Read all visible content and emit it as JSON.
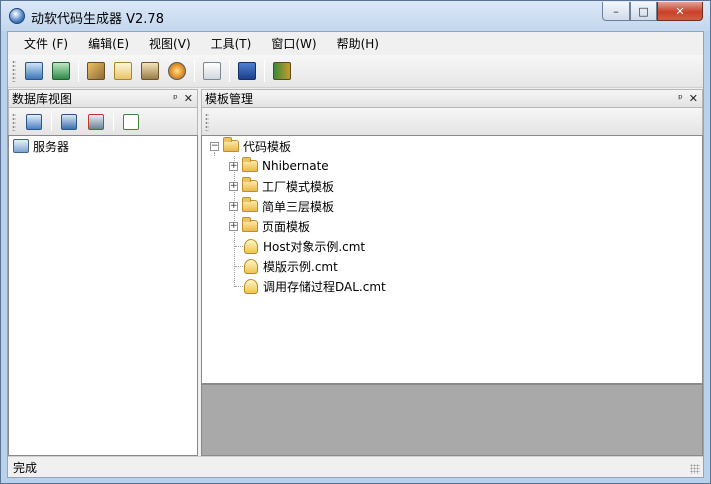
{
  "window": {
    "title": "动软代码生成器  V2.78",
    "minimize_glyph": "–",
    "maximize_glyph": "□",
    "close_glyph": "✕"
  },
  "menu": {
    "items": [
      "文件 (F)",
      "编辑(E)",
      "视图(V)",
      "工具(T)",
      "窗口(W)",
      "帮助(H)"
    ]
  },
  "toolbar": {
    "icons": [
      "server-connect-icon",
      "code-generator-icon",
      "tools-icon",
      "document-icon",
      "batch-icon",
      "refresh-gear-icon",
      "clipboard-icon",
      "word-icon",
      "exit-icon"
    ]
  },
  "left_panel": {
    "title": "数据库视图",
    "pin_glyph": "ᵖ",
    "close_glyph": "✕",
    "toolbar_icons": [
      "add-server-icon",
      "connect-icon",
      "disconnect-icon",
      "refresh-icon"
    ],
    "tree": [
      {
        "label": "服务器",
        "icon": "server-icon"
      }
    ]
  },
  "right_panel": {
    "title": "模板管理",
    "pin_glyph": "ᵖ",
    "close_glyph": "✕",
    "tree": {
      "root": {
        "label": "代码模板",
        "expanded": true
      },
      "children": [
        {
          "label": "Nhibernate",
          "type": "folder",
          "expander": "+"
        },
        {
          "label": "工厂模式模板",
          "type": "folder",
          "expander": "+"
        },
        {
          "label": "简单三层模板",
          "type": "folder",
          "expander": "+"
        },
        {
          "label": "页面模板",
          "type": "folder",
          "expander": "+"
        },
        {
          "label": "Host对象示例.cmt",
          "type": "file"
        },
        {
          "label": "模版示例.cmt",
          "type": "file"
        },
        {
          "label": "调用存储过程DAL.cmt",
          "type": "file"
        }
      ]
    }
  },
  "statusbar": {
    "text": "完成"
  },
  "colors": {
    "title_bg": "#c3d7ee",
    "client_bg": "#f0f0f0",
    "grey_area": "#a9a9a9",
    "close_red": "#c9402b"
  }
}
